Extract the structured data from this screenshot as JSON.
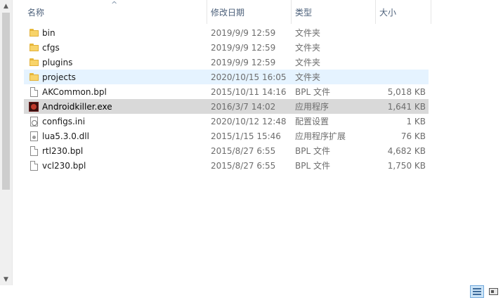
{
  "header": {
    "name": "名称",
    "date": "修改日期",
    "type": "类型",
    "size": "大小",
    "sort_glyph": "^"
  },
  "files": [
    {
      "name": "bin",
      "date": "2019/9/9 12:59",
      "type": "文件夹",
      "size": "",
      "icon": "folder-icon"
    },
    {
      "name": "cfgs",
      "date": "2019/9/9 12:59",
      "type": "文件夹",
      "size": "",
      "icon": "folder-icon"
    },
    {
      "name": "plugins",
      "date": "2019/9/9 12:59",
      "type": "文件夹",
      "size": "",
      "icon": "folder-icon"
    },
    {
      "name": "projects",
      "date": "2020/10/15 16:05",
      "type": "文件夹",
      "size": "",
      "icon": "folder-icon"
    },
    {
      "name": "AKCommon.bpl",
      "date": "2015/10/11 14:16",
      "type": "BPL 文件",
      "size": "5,018 KB",
      "icon": "file-icon"
    },
    {
      "name": "Androidkiller.exe",
      "date": "2016/3/7 14:02",
      "type": "应用程序",
      "size": "1,641 KB",
      "icon": "exe-icon"
    },
    {
      "name": "configs.ini",
      "date": "2020/10/12 12:48",
      "type": "配置设置",
      "size": "1 KB",
      "icon": "ini-icon"
    },
    {
      "name": "lua5.3.0.dll",
      "date": "2015/1/15 15:46",
      "type": "应用程序扩展",
      "size": "76 KB",
      "icon": "dll-icon"
    },
    {
      "name": "rtl230.bpl",
      "date": "2015/8/27 6:55",
      "type": "BPL 文件",
      "size": "4,682 KB",
      "icon": "file-icon"
    },
    {
      "name": "vcl230.bpl",
      "date": "2015/8/27 6:55",
      "type": "BPL 文件",
      "size": "1,750 KB",
      "icon": "file-icon"
    }
  ],
  "scrollbar": {
    "up_glyph": "▲",
    "down_glyph": "▼"
  },
  "colors": {
    "hover_row": "#e5f3ff",
    "selected_row": "#d9d9d9",
    "folder": "#f8d46a"
  }
}
